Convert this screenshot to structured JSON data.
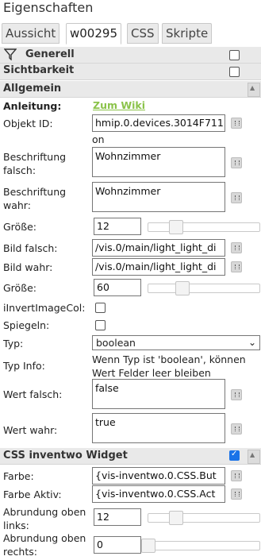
{
  "panel": {
    "title": "Eigenschaften"
  },
  "tabs": [
    {
      "label": "Aussicht",
      "active": false
    },
    {
      "label": "w00295",
      "active": true
    },
    {
      "label": "CSS",
      "active": false
    },
    {
      "label": "Skripte",
      "active": false
    }
  ],
  "groups": {
    "generell": {
      "label": "Generell",
      "checked": false
    },
    "sichtbarkeit": {
      "label": "Sichtbarkeit",
      "checked": false
    },
    "allgemein": {
      "label": "Allgemein"
    },
    "css_inventwo": {
      "label": "CSS inventwo Widget",
      "checked": true
    }
  },
  "fields": {
    "anleitung": {
      "label": "Anleitung:",
      "link": "Zum Wiki"
    },
    "objekt_id": {
      "label": "Objekt ID:",
      "value": "hmip.0.devices.3014F711",
      "state": "on"
    },
    "beschriftung_falsch": {
      "label": "Beschriftung falsch:",
      "value": "Wohnzimmer"
    },
    "beschriftung_wahr": {
      "label": "Beschriftung wahr:",
      "value": "Wohnzimmer"
    },
    "groesse1": {
      "label": "Größe:",
      "value": "12",
      "slider_fraction": 0.22
    },
    "bild_falsch": {
      "label": "Bild falsch:",
      "value": "/vis.0/main/light_light_di"
    },
    "bild_wahr": {
      "label": "Bild wahr:",
      "value": "/vis.0/main/light_light_di"
    },
    "groesse2": {
      "label": "Größe:",
      "value": "60",
      "slider_fraction": 0.38
    },
    "invert": {
      "label": "iInvertImageCol:",
      "checked": false
    },
    "spiegeln": {
      "label": "Spiegeln:",
      "checked": false
    },
    "typ": {
      "label": "Typ:",
      "value": "boolean"
    },
    "typ_info": {
      "label": "Typ Info:",
      "value": "Wenn Typ ist 'boolean', können Wert Felder leer bleiben"
    },
    "wert_falsch": {
      "label": "Wert falsch:",
      "value": "false"
    },
    "wert_wahr": {
      "label": "Wert wahr:",
      "value": "true"
    },
    "farbe": {
      "label": "Farbe:",
      "value": "{vis-inventwo.0.CSS.But"
    },
    "farbe_aktiv": {
      "label": "Farbe Aktiv:",
      "value": "{vis-inventwo.0.CSS.Act"
    },
    "abrundung_ol": {
      "label": "Abrundung oben links:",
      "value": "12",
      "slider_fraction": 0.22
    },
    "abrundung_or": {
      "label": "Abrundung oben rechts:",
      "value": "0",
      "slider_fraction": 0.0
    }
  },
  "colors": {
    "accent": "#1a73e8",
    "link": "#8bc34a",
    "group_bg": "#e9e9e9"
  }
}
